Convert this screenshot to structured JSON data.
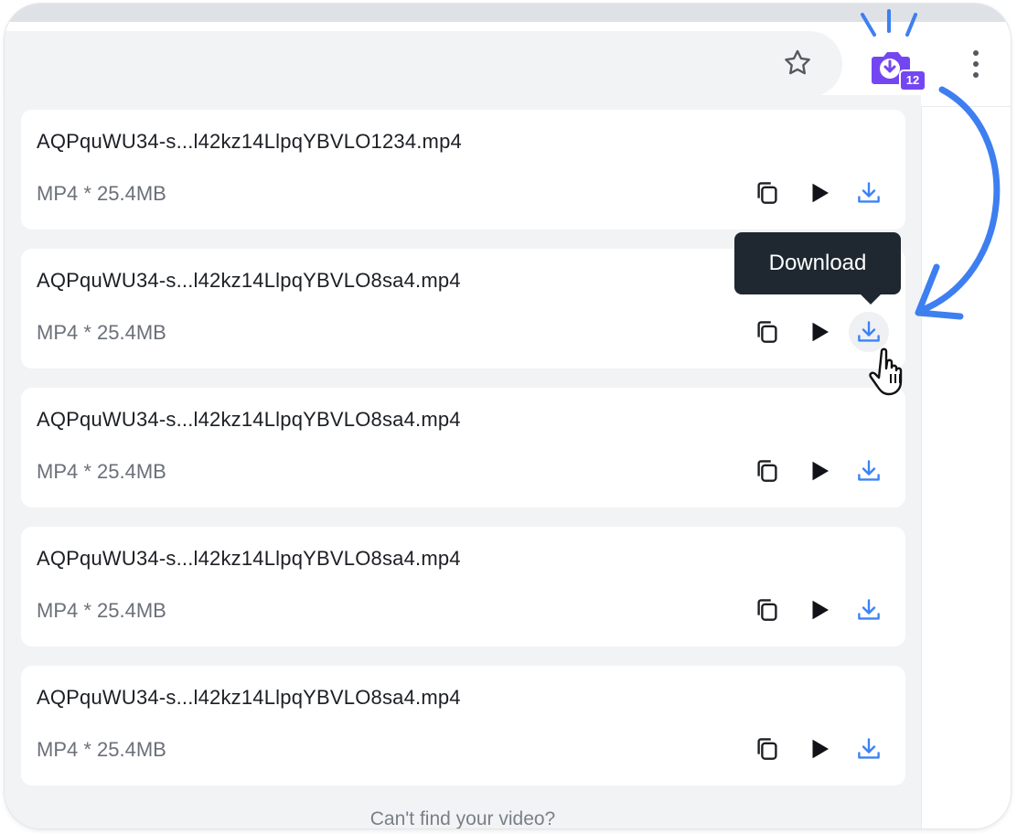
{
  "toolbar": {
    "extension_badge": "12",
    "icons": [
      "star-icon",
      "download-extension-icon",
      "more-vert-icon"
    ]
  },
  "files": [
    {
      "name": "AQPquWU34-s...l42kz14LlpqYBVLO1234.mp4",
      "meta": "MP4 * 25.4MB"
    },
    {
      "name": "AQPquWU34-s...l42kz14LlpqYBVLO8sa4.mp4",
      "meta": "MP4 * 25.4MB"
    },
    {
      "name": "AQPquWU34-s...l42kz14LlpqYBVLO8sa4.mp4",
      "meta": "MP4 * 25.4MB"
    },
    {
      "name": "AQPquWU34-s...l42kz14LlpqYBVLO8sa4.mp4",
      "meta": "MP4 * 25.4MB"
    },
    {
      "name": "AQPquWU34-s...l42kz14LlpqYBVLO8sa4.mp4",
      "meta": "MP4 * 25.4MB"
    }
  ],
  "row_icons": [
    "copy-icon",
    "play-icon",
    "download-icon"
  ],
  "tooltip": {
    "label": "Download"
  },
  "footer": {
    "link": "Can't find your video?"
  },
  "colors": {
    "accent": "#3b82f6",
    "extension": "#7446f2",
    "arrow": "#3d7ff0",
    "tooltip_bg": "#1f2730"
  }
}
